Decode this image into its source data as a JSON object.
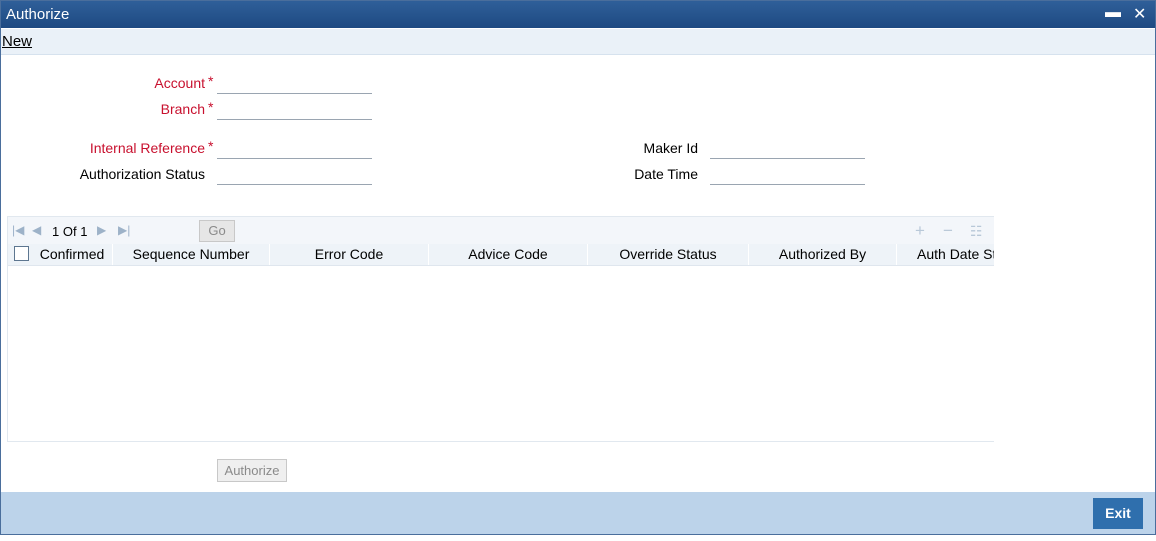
{
  "window": {
    "title": "Authorize",
    "minimize_icon": "minus-icon",
    "close_icon": "x-icon"
  },
  "menu": {
    "new_label": "New"
  },
  "form": {
    "account_label": "Account",
    "branch_label": "Branch",
    "internal_reference_label": "Internal Reference",
    "authorization_status_label": "Authorization Status",
    "maker_id_label": "Maker Id",
    "date_time_label": "Date Time",
    "required_marker": "*"
  },
  "grid": {
    "page_current": "1",
    "page_of": "Of",
    "page_total": "1",
    "go_label": "Go",
    "columns": [
      "Confirmed",
      "Sequence Number",
      "Error Code",
      "Advice Code",
      "Override Status",
      "Authorized By",
      "Auth Date St"
    ],
    "rows": []
  },
  "actions": {
    "authorize_label": "Authorize",
    "exit_label": "Exit"
  },
  "colors": {
    "titlebar": "#1e4a82",
    "required": "#c8102e",
    "footer": "#bcd3ea",
    "exit_button": "#2f6fad"
  }
}
